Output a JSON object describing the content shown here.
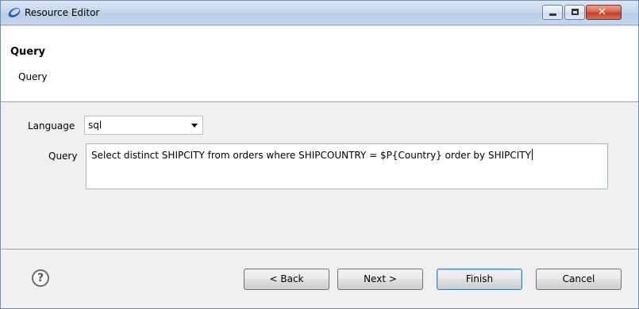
{
  "window": {
    "title": "Resource Editor",
    "controls": {
      "minimize": "",
      "maximize": "",
      "close": "✕"
    }
  },
  "header": {
    "title": "Query",
    "subtitle": "Query"
  },
  "form": {
    "language_label": "Language",
    "language_value": "sql",
    "query_label": "Query",
    "query_value": "Select distinct SHIPCITY from orders where SHIPCOUNTRY = $P{Country} order by SHIPCITY"
  },
  "footer": {
    "help": "?",
    "back_label": "< Back",
    "next_label": "Next >",
    "finish_label": "Finish",
    "cancel_label": "Cancel"
  },
  "icons": {
    "app": "eclipse-app-icon",
    "help": "help-icon",
    "dropdown": "chevron-down-icon"
  },
  "colors": {
    "titlebar": "#c7d7ec",
    "close_button": "#c1412a",
    "default_button_border": "#3c7fb1"
  }
}
